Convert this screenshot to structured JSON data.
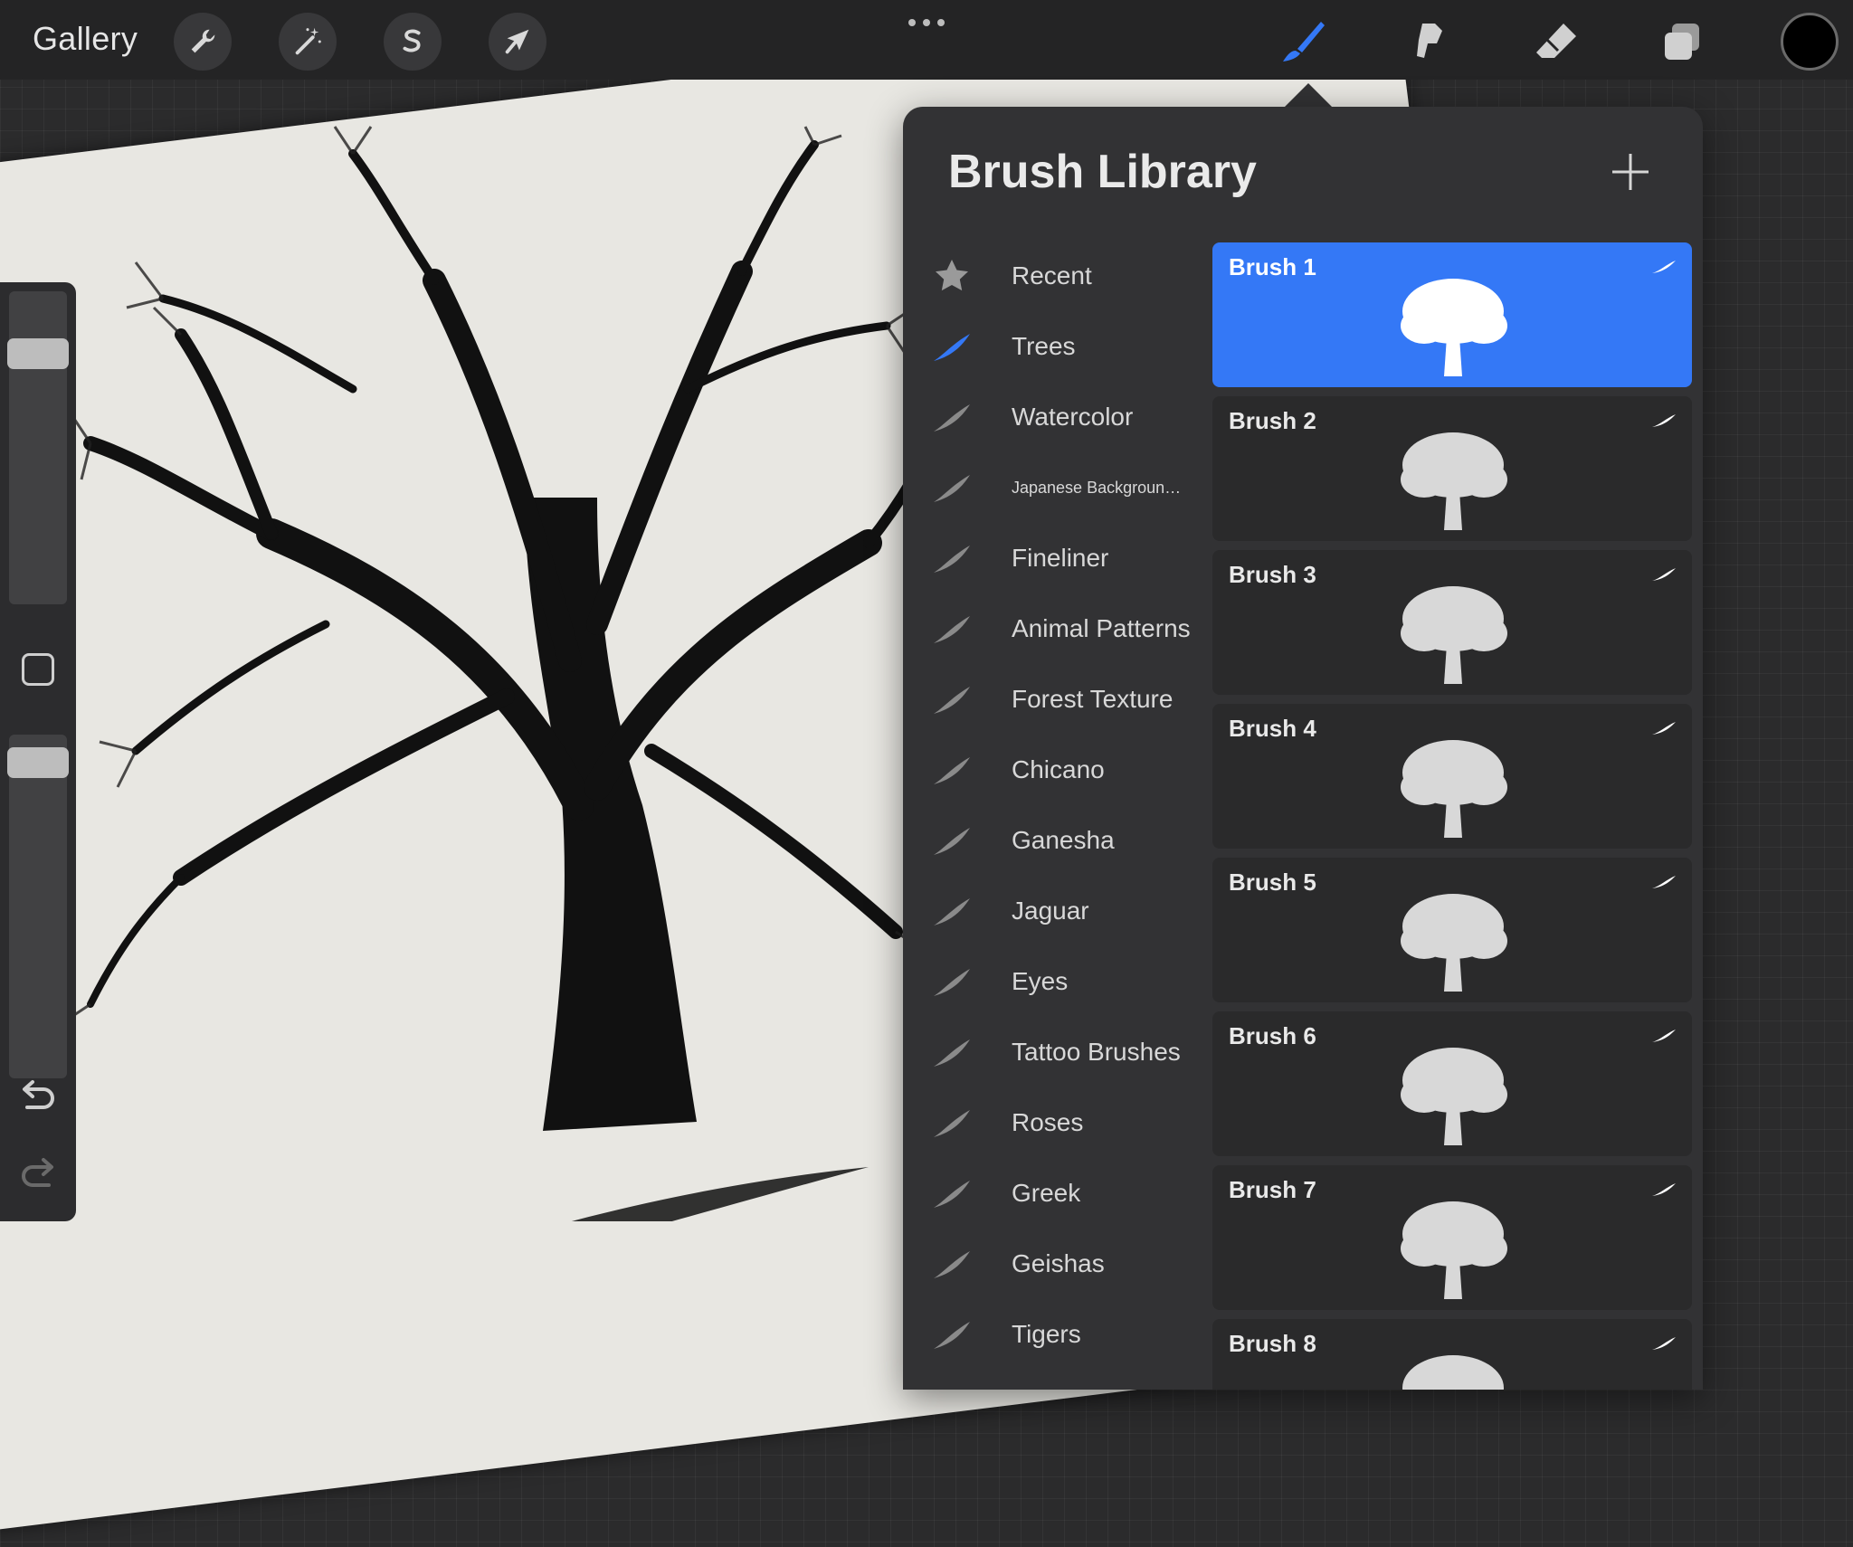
{
  "topbar": {
    "gallery_label": "Gallery",
    "left_tools": [
      "wrench-icon",
      "magic-wand-icon",
      "selection-s-icon",
      "arrow-cursor-icon"
    ],
    "right_tools": [
      "brush-icon",
      "smudge-icon",
      "eraser-icon",
      "layers-icon"
    ],
    "active_tool": "brush-icon",
    "accent_color": "#3478f6",
    "current_color": "#000000"
  },
  "sidebar": {
    "size_slider_value": 0.12,
    "opacity_slider_value": 0.05
  },
  "brush_library": {
    "title": "Brush Library",
    "brush_sets": [
      {
        "label": "Recent",
        "icon": "star-icon"
      },
      {
        "label": "Trees",
        "icon": "brush-stroke-icon",
        "active": true
      },
      {
        "label": "Watercolor",
        "icon": "brush-stroke-icon"
      },
      {
        "label": "Japanese Backgroun…",
        "icon": "brush-stroke-icon"
      },
      {
        "label": "Fineliner",
        "icon": "brush-stroke-icon"
      },
      {
        "label": "Animal Patterns",
        "icon": "brush-stroke-icon"
      },
      {
        "label": "Forest Texture",
        "icon": "brush-stroke-icon"
      },
      {
        "label": "Chicano",
        "icon": "brush-stroke-icon"
      },
      {
        "label": "Ganesha",
        "icon": "brush-stroke-icon"
      },
      {
        "label": "Jaguar",
        "icon": "brush-stroke-icon"
      },
      {
        "label": "Eyes",
        "icon": "brush-stroke-icon"
      },
      {
        "label": "Tattoo Brushes",
        "icon": "brush-stroke-icon"
      },
      {
        "label": "Roses",
        "icon": "brush-stroke-icon"
      },
      {
        "label": "Greek",
        "icon": "brush-stroke-icon"
      },
      {
        "label": "Geishas",
        "icon": "brush-stroke-icon"
      },
      {
        "label": "Tigers",
        "icon": "brush-stroke-icon"
      }
    ],
    "brushes": [
      {
        "name": "Brush 1",
        "active": true
      },
      {
        "name": "Brush 2"
      },
      {
        "name": "Brush 3"
      },
      {
        "name": "Brush 4"
      },
      {
        "name": "Brush 5"
      },
      {
        "name": "Brush 6"
      },
      {
        "name": "Brush 7"
      },
      {
        "name": "Brush 8"
      }
    ]
  }
}
